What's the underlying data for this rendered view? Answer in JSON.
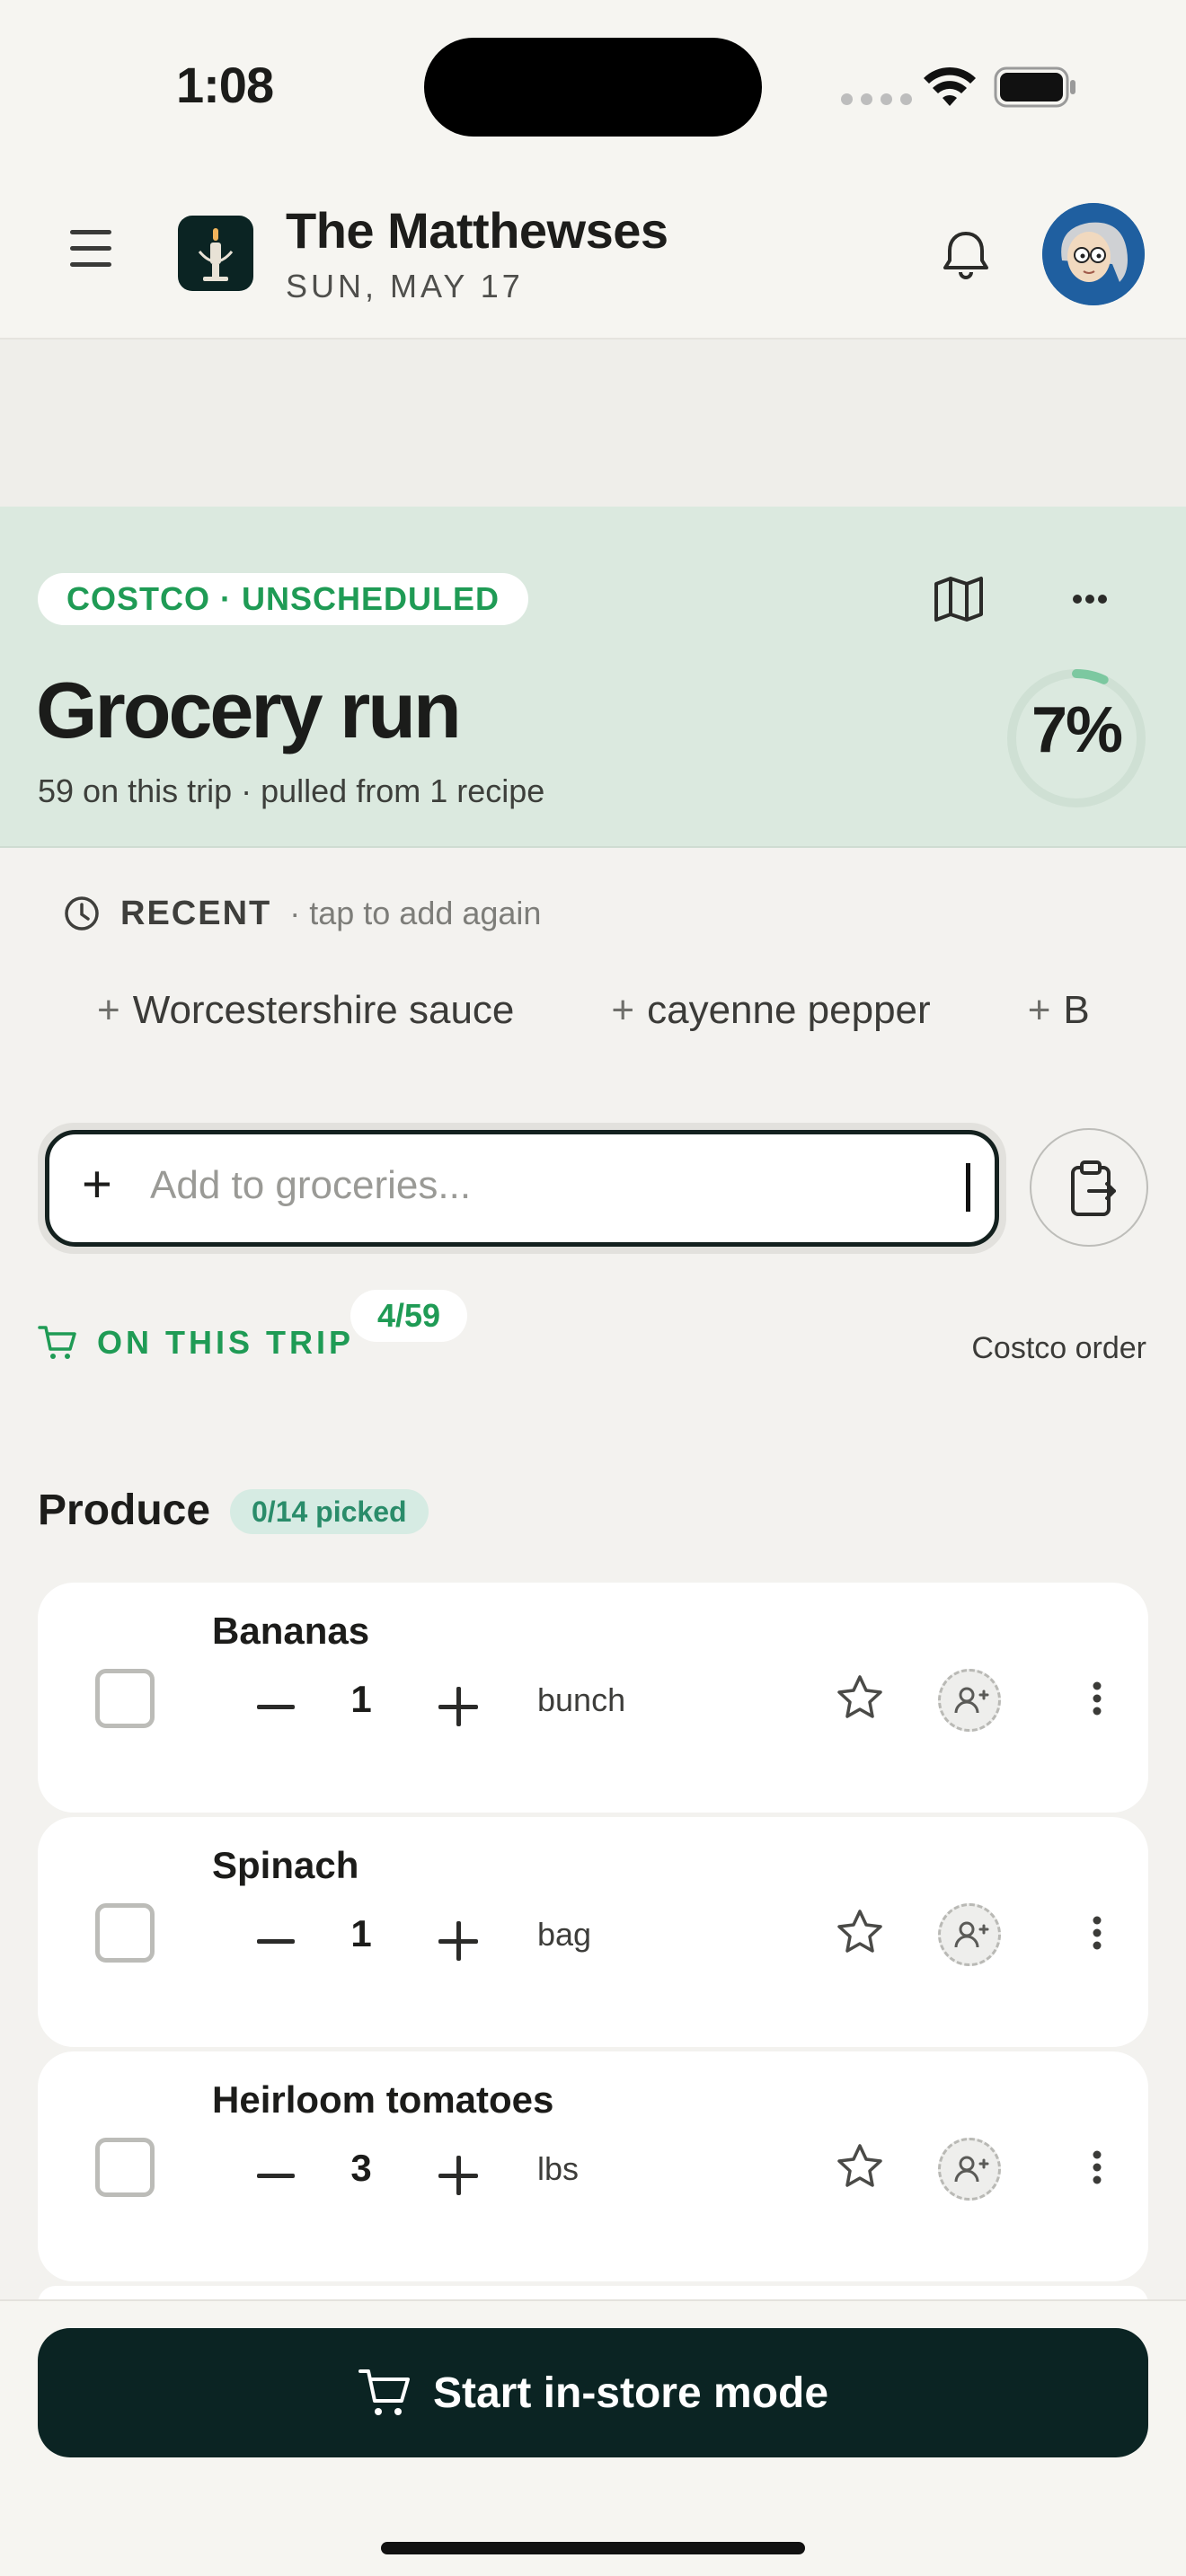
{
  "status_bar": {
    "time": "1:08"
  },
  "header": {
    "family_name": "The Matthewses",
    "date": "SUN, MAY 17"
  },
  "hero": {
    "store_badge": "COSTCO · UNSCHEDULED",
    "title": "Grocery run",
    "subtitle": "59 on this trip · pulled from 1 recipe",
    "progress_percent": 7,
    "progress_label": "7%"
  },
  "recent": {
    "title": "RECENT",
    "hint": "· tap to add again",
    "chips": [
      "Worcestershire sauce",
      "cayenne pepper",
      "B"
    ]
  },
  "add_input": {
    "placeholder": "Add to groceries..."
  },
  "trip": {
    "title": "ON THIS TRIP",
    "count": "4/59",
    "store_link": "Costco order"
  },
  "category": {
    "name": "Produce",
    "picked": "0/14 picked",
    "items": [
      {
        "name": "Bananas",
        "qty": "1",
        "unit": "bunch"
      },
      {
        "name": "Spinach",
        "qty": "1",
        "unit": "bag"
      },
      {
        "name": "Heirloom tomatoes",
        "qty": "3",
        "unit": "lbs"
      }
    ]
  },
  "cta": {
    "label": "Start in-store mode"
  },
  "colors": {
    "accent_green": "#1f9b55",
    "hero_bg": "#dbe9df",
    "cta_bg": "#0b2423"
  }
}
